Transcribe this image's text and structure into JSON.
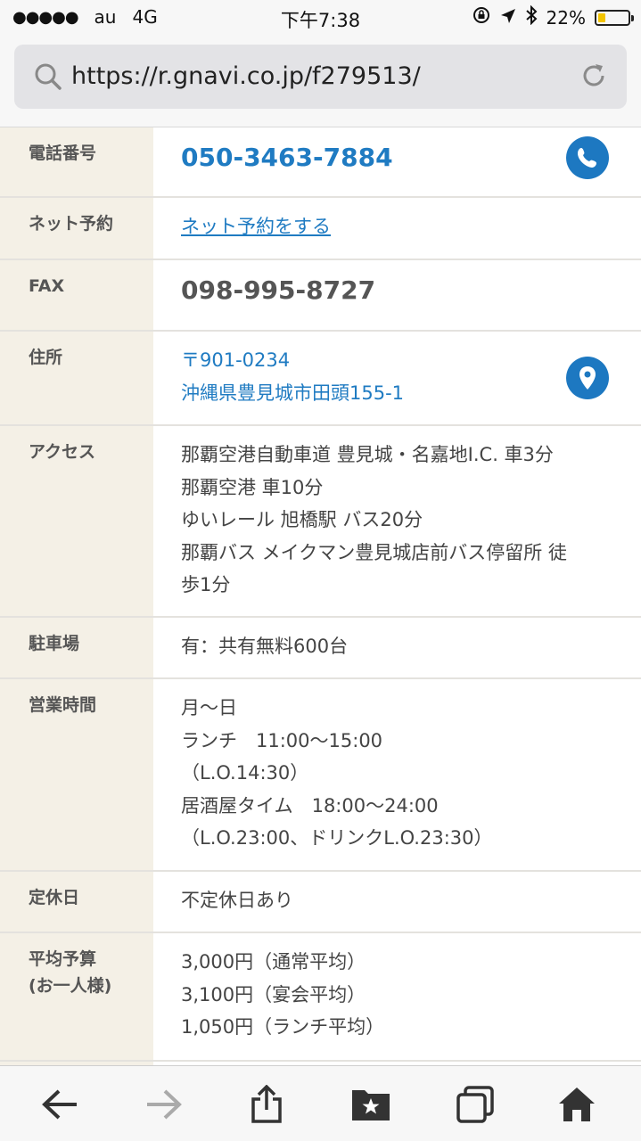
{
  "status_bar": {
    "signal": "●●●●●",
    "carrier": "au",
    "network": "4G",
    "time": "下午7:38",
    "battery_percent": "22%",
    "battery_level": 0.22,
    "battery_color": "#f3c400"
  },
  "browser": {
    "url": "https://r.gnavi.co.jp/f279513/",
    "icons": [
      "search-icon",
      "reload-icon"
    ]
  },
  "info": {
    "phone": {
      "label": "電話番号",
      "value": "050-3463-7884",
      "icon": "phone-icon"
    },
    "reserve": {
      "label": "ネット予約",
      "value": "ネット予約をする"
    },
    "fax": {
      "label": "FAX",
      "value": "098-995-8727"
    },
    "address": {
      "label": "住所",
      "lines": [
        "〒901-0234",
        "沖縄県豊見城市田頭155-1"
      ],
      "icon": "map-pin-icon"
    },
    "access": {
      "label": "アクセス",
      "lines": [
        "那覇空港自動車道 豊見城・名嘉地I.C. 車3分",
        "那覇空港 車10分",
        "ゆいレール 旭橋駅 バス20分",
        "那覇バス メイクマン豊見城店前バス停留所 徒",
        "歩1分"
      ]
    },
    "parking": {
      "label": "駐車場",
      "value": "有：共有無料600台"
    },
    "hours": {
      "label": "営業時間",
      "lines": [
        "月〜日",
        "ランチ　11:00〜15:00",
        "（L.O.14:30）",
        "居酒屋タイム　18:00〜24:00",
        "（L.O.23:00、ドリンクL.O.23:30）"
      ]
    },
    "holiday": {
      "label": "定休日",
      "value": "不定休日あり"
    },
    "budget": {
      "label_lines": [
        "平均予算",
        "(お一人様)"
      ],
      "lines": [
        "3,000円（通常平均）",
        "3,100円（宴会平均）",
        "1,050円（ランチ平均）"
      ]
    }
  },
  "toolbar": {
    "icons": [
      "back-icon",
      "forward-icon",
      "share-icon",
      "bookmarks-icon",
      "tabs-icon",
      "home-icon"
    ]
  },
  "colors": {
    "accent": "#1f7bc2",
    "label_bg": "#f4f0e6",
    "divider": "#e4e2de"
  }
}
